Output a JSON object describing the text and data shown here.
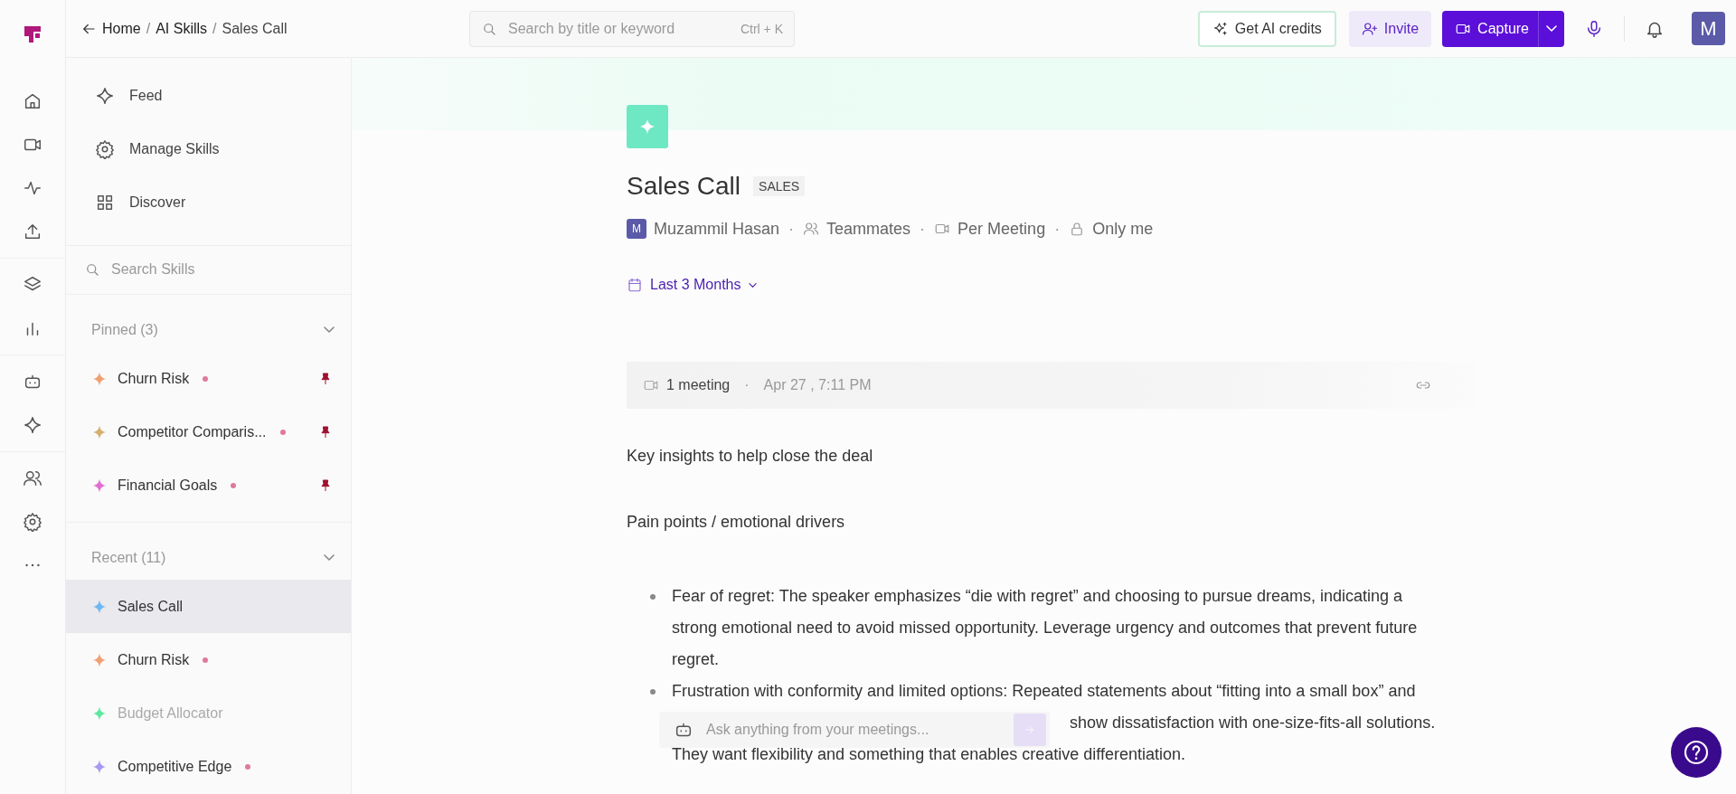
{
  "topbar": {
    "breadcrumb": [
      {
        "kind": "link",
        "text": "Home"
      },
      {
        "kind": "sep",
        "text": "/"
      },
      {
        "kind": "link",
        "text": "AI Skills"
      },
      {
        "kind": "sep",
        "text": "/"
      },
      {
        "kind": "current",
        "text": "Sales Call"
      }
    ],
    "search": {
      "placeholder": "Search by title or keyword",
      "shortcut": "Ctrl + K"
    },
    "buttons": [
      {
        "kind": "credits",
        "label": "Get AI credits"
      },
      {
        "kind": "invite",
        "label": "Invite"
      },
      {
        "kind": "capture",
        "label": "Capture"
      }
    ],
    "avatar": "M"
  },
  "sidebar": {
    "nav": [
      {
        "kind": "feed",
        "label": "Feed"
      },
      {
        "kind": "manage",
        "label": "Manage Skills"
      },
      {
        "kind": "discover",
        "label": "Discover"
      }
    ],
    "search": {
      "placeholder": "Search Skills"
    },
    "sections": [
      {
        "title": "Pinned (3)",
        "expanded": true,
        "items": [
          {
            "label": "Churn Risk",
            "color": "#f0a070",
            "dot": true,
            "pinned": true,
            "selected": false,
            "disabled": false
          },
          {
            "label": "Competitor Comparis...",
            "color": "#d7b070",
            "dot": true,
            "pinned": true,
            "selected": false,
            "disabled": false
          },
          {
            "label": "Financial Goals",
            "color": "#e070d0",
            "dot": true,
            "pinned": true,
            "selected": false,
            "disabled": false
          }
        ]
      },
      {
        "title": "Recent (11)",
        "expanded": true,
        "items": [
          {
            "label": "Sales Call",
            "color": "#70b8f0",
            "dot": false,
            "pinned": false,
            "selected": true,
            "disabled": false
          },
          {
            "label": "Churn Risk",
            "color": "#f0a070",
            "dot": true,
            "pinned": false,
            "selected": false,
            "disabled": false
          },
          {
            "label": "Budget Allocator",
            "color": "#60e8a0",
            "dot": false,
            "pinned": false,
            "selected": false,
            "disabled": true
          },
          {
            "label": "Competitive Edge",
            "color": "#a898f0",
            "dot": true,
            "pinned": false,
            "selected": false,
            "disabled": false
          }
        ]
      }
    ]
  },
  "skill": {
    "title": "Sales Call",
    "tag": "SALES",
    "owner_initial": "M",
    "owner": "Muzammil Hasan",
    "meta": [
      {
        "kind": "sep",
        "label": "·"
      },
      {
        "kind": "team",
        "label": "Teammates"
      },
      {
        "kind": "sep",
        "label": "·"
      },
      {
        "kind": "meeting",
        "label": "Per Meeting"
      },
      {
        "kind": "sep",
        "label": "·"
      },
      {
        "kind": "private",
        "label": "Only me"
      }
    ],
    "date_filter": "Last 3 Months"
  },
  "meeting_row": {
    "count": "1 meeting",
    "separator": "·",
    "date": "Apr 27 , 7:11 PM"
  },
  "content": [
    {
      "kind": "paragraph",
      "text": "Key insights to help close the deal"
    },
    {
      "kind": "paragraph",
      "text": "Pain points / emotional drivers"
    },
    {
      "kind": "bullet",
      "lines": [
        {
          "text": "Fear of regret: The speaker emphasizes “die with regret” and choosing to pursue dreams, indicating a",
          "covered_start": false
        },
        {
          "text": "strong emotional need to avoid missed opportunity. Leverage urgency and outcomes that prevent future",
          "covered_start": false
        },
        {
          "text": "regret.",
          "covered_start": false
        }
      ]
    },
    {
      "kind": "bullet",
      "lines": [
        {
          "text": "Frustration with conformity and limited options: Repeated statements about “fitting into a small box” and",
          "covered_start": false
        },
        {
          "text": "show dissatisfaction with one-size-fits-all solutions.",
          "covered_start": true
        },
        {
          "text": "They want flexibility and something that enables creative differentiation.",
          "covered_start": false
        }
      ]
    }
  ],
  "ask_box": {
    "placeholder": "Ask anything from your meetings..."
  }
}
